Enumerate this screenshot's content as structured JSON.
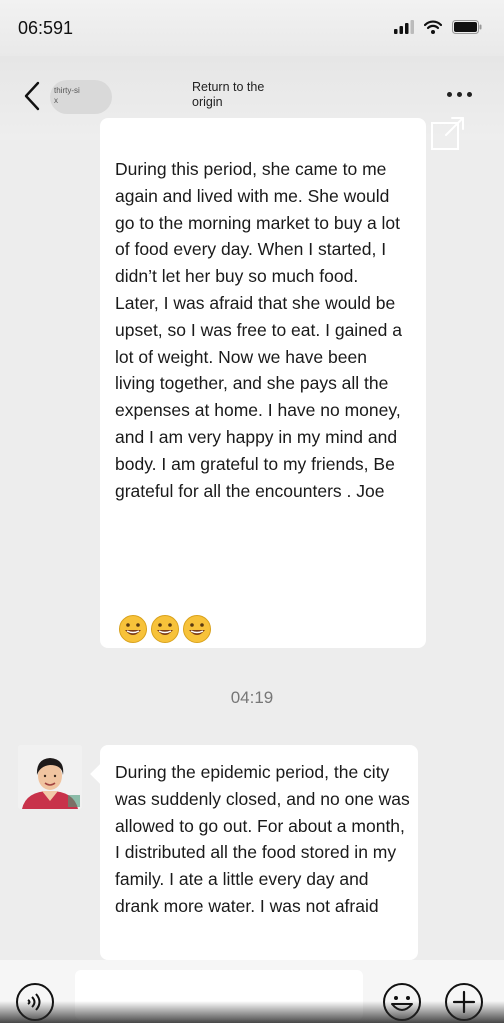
{
  "status_bar": {
    "time": "06:591"
  },
  "header": {
    "contact_name": "thirty-si\nx",
    "title": "Return to the origin"
  },
  "messages": [
    {
      "text": "During this period, she came to me again and lived with me. She would go to the morning market to buy a lot of food every day. When I started, I didn’t let her buy so much food. Later, I was afraid that she would be upset, so I was free to eat. I gained a lot of weight. Now we have been living together, and she pays all the expenses at home. I have no money, and I am very happy in my mind and body. I am grateful to my friends, Be grateful for all the encounters . Joe",
      "emojis": [
        "grinning-face-emoji",
        "grinning-face-emoji",
        "grinning-face-emoji"
      ]
    },
    {
      "text": "During the epidemic period, the city was suddenly closed, and no one was allowed to go out. For about a month, I distributed all the food stored in my family. I ate a little every day and drank more water. I was not afraid"
    }
  ],
  "timestamp": "04:19",
  "input": {
    "placeholder": ""
  },
  "colors": {
    "background": "#ededed",
    "bubble": "#ffffff"
  }
}
